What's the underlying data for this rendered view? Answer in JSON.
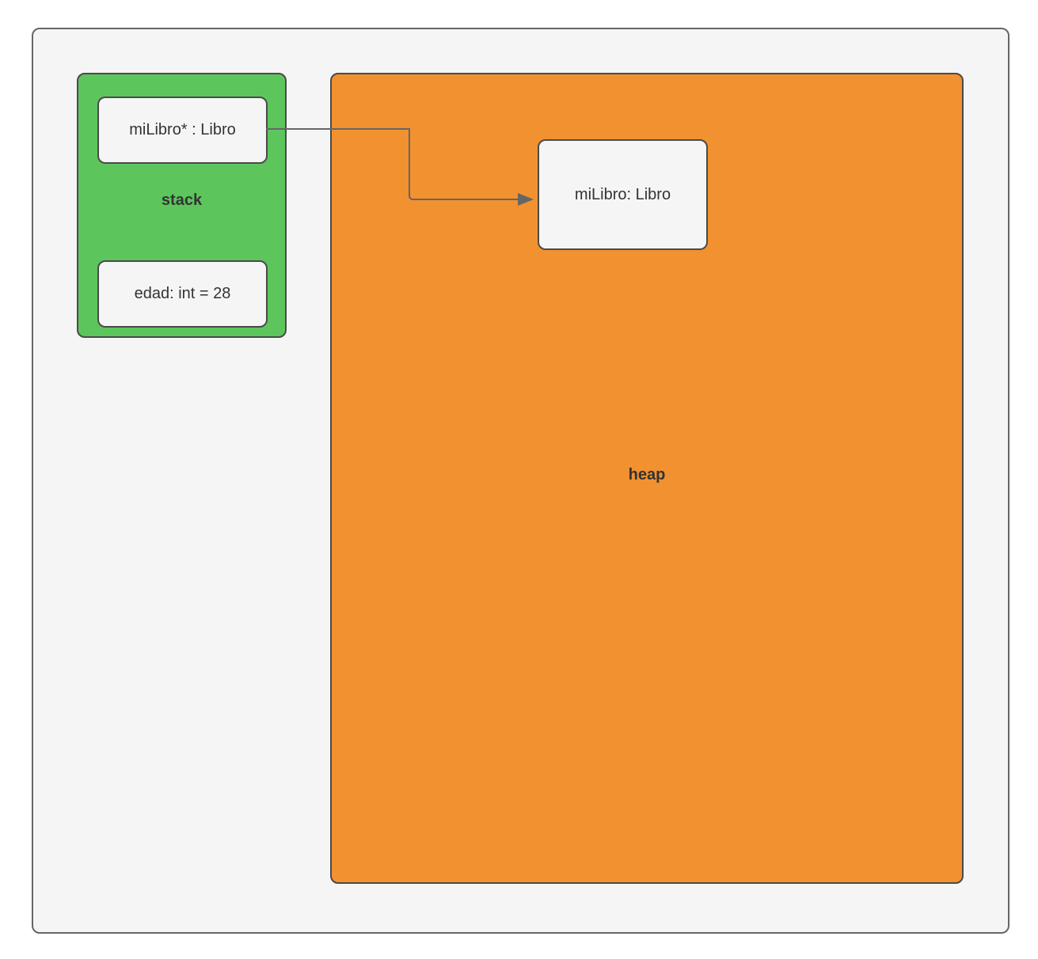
{
  "diagram": {
    "stack": {
      "label": "stack",
      "cells": [
        {
          "text": "miLibro* : Libro"
        },
        {
          "text": "edad: int = 28"
        }
      ]
    },
    "heap": {
      "label": "heap",
      "cells": [
        {
          "text": "miLibro: Libro"
        }
      ]
    },
    "arrow": {
      "from": "stack.cells.0",
      "to": "heap.cells.0"
    },
    "colors": {
      "stackFill": "#5cc65c",
      "heapFill": "#f29130",
      "cellFill": "#f5f5f5",
      "border": "#4a4a4a",
      "outerFill": "#f5f5f5"
    }
  }
}
